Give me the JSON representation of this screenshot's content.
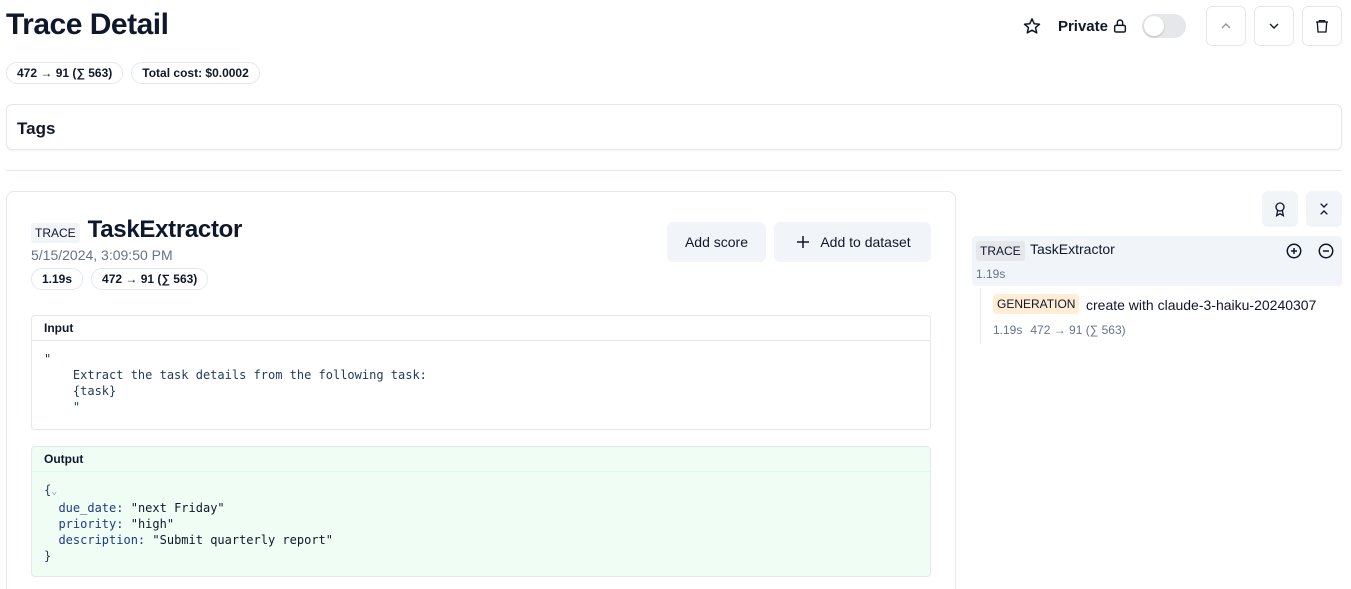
{
  "page": {
    "title": "Trace Detail"
  },
  "header": {
    "private_label": "Private",
    "usage_pill": "472 → 91 (∑ 563)",
    "cost_pill": "Total cost: $0.0002"
  },
  "tags": {
    "label": "Tags"
  },
  "detail": {
    "type": "TRACE",
    "name": "TaskExtractor",
    "timestamp": "5/15/2024, 3:09:50 PM",
    "latency": "1.19s",
    "usage": "472 → 91 (∑ 563)",
    "add_score_label": "Add score",
    "add_dataset_label": "Add to dataset",
    "input": {
      "label": "Input",
      "lines": [
        "\"",
        "    Extract the task details from the following task:",
        "    {task}",
        "    \""
      ]
    },
    "output": {
      "label": "Output",
      "open_brace": "{",
      "close_brace": "}",
      "fields": [
        {
          "key": "due_date:",
          "value": "\"next Friday\""
        },
        {
          "key": "priority:",
          "value": "\"high\""
        },
        {
          "key": "description:",
          "value": "\"Submit quarterly report\""
        }
      ]
    }
  },
  "tree": {
    "root": {
      "type": "TRACE",
      "name": "TaskExtractor",
      "latency": "1.19s"
    },
    "child": {
      "type": "GENERATION",
      "name": "create with claude-3-haiku-20240307",
      "latency": "1.19s",
      "usage": "472 → 91 (∑ 563)"
    }
  },
  "colors": {
    "output_bg": "#f0fdf4",
    "generation_badge": "#ffedd5",
    "muted_text": "#64748b"
  }
}
